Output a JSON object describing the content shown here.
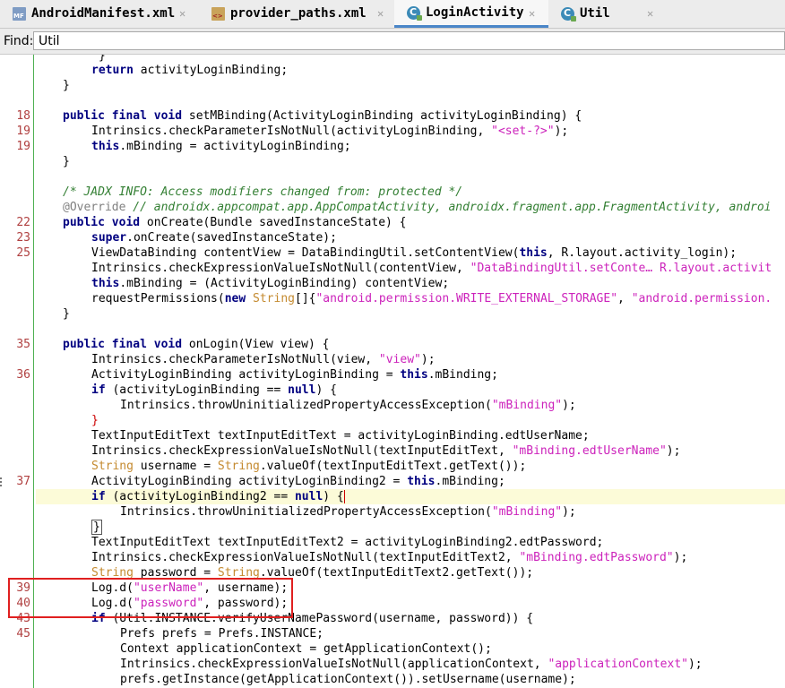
{
  "tabs": [
    {
      "label": "AndroidManifest.xml",
      "icon": "manifest-file-icon",
      "active": false
    },
    {
      "label": "provider_paths.xml",
      "icon": "xml-file-icon",
      "active": false
    },
    {
      "label": "LoginActivity",
      "icon": "java-class-icon",
      "active": true
    },
    {
      "label": "Util",
      "icon": "java-class-icon",
      "active": false
    }
  ],
  "close_glyph": "✕",
  "find": {
    "label": "Find:",
    "value": "Util"
  },
  "code": {
    "l0": {
      "num": "",
      "a": "}"
    },
    "l1": {
      "num": "",
      "kw1": "return",
      "a": " activityLoginBinding;"
    },
    "l2": {
      "num": "",
      "a": "}"
    },
    "l4": {
      "num": "18",
      "kw1": "public final void",
      "a": " setMBinding(ActivityLoginBinding activityLoginBinding) {"
    },
    "l5": {
      "num": "19",
      "a": "Intrinsics.checkParameterIsNotNull(activityLoginBinding, ",
      "s1": "\"<set-?>\"",
      "b": ");"
    },
    "l6": {
      "num": "19",
      "kw1": "this",
      "a": ".mBinding = activityLoginBinding;"
    },
    "l7": {
      "num": "",
      "a": "}"
    },
    "l9": {
      "num": "",
      "c": "/* JADX INFO: Access modifiers changed from: protected */"
    },
    "l10": {
      "num": "",
      "ann": "@Override",
      "c": " // androidx.appcompat.app.AppCompatActivity, androidx.fragment.app.FragmentActivity, androi"
    },
    "l11": {
      "num": "22",
      "kw1": "public void",
      "a": " onCreate(Bundle savedInstanceState) {"
    },
    "l12": {
      "num": "23",
      "kw1": "super",
      "a": ".onCreate(savedInstanceState);"
    },
    "l13": {
      "num": "25",
      "a": "ViewDataBinding contentView = DataBindingUtil.setContentView(",
      "kw2": "this",
      "b": ", R.layout.activity_login);"
    },
    "l14": {
      "num": "",
      "a": "Intrinsics.checkExpressionValueIsNotNull(contentView, ",
      "s1": "\"DataBindingUtil.setConte… R.layout.activit"
    },
    "l15": {
      "num": "",
      "kw1": "this",
      "a": ".mBinding = (ActivityLoginBinding) contentView;"
    },
    "l16": {
      "num": "",
      "a": "requestPermissions(",
      "kw2": "new",
      "t": " String",
      "b": "[]{",
      "s1": "\"android.permission.WRITE_EXTERNAL_STORAGE\"",
      "c2": ", ",
      "s2": "\"android.permission."
    },
    "l17": {
      "num": "",
      "a": "}"
    },
    "l19": {
      "num": "35",
      "kw1": "public final void",
      "a": " onLogin(View view) {"
    },
    "l20": {
      "num": "",
      "a": "Intrinsics.checkParameterIsNotNull(view, ",
      "s1": "\"view\"",
      "b": ");"
    },
    "l21": {
      "num": "36",
      "a": "ActivityLoginBinding activityLoginBinding = ",
      "kw2": "this",
      "b": ".mBinding;"
    },
    "l22": {
      "num": "",
      "kw1": "if",
      "a": " (activityLoginBinding == ",
      "kw2": "null",
      "b": ") {"
    },
    "l23": {
      "num": "",
      "a": "Intrinsics.throwUninitializedPropertyAccessException(",
      "s1": "\"mBinding\"",
      "b": ");"
    },
    "l24": {
      "num": "",
      "a": "}"
    },
    "l25": {
      "num": "",
      "a": "TextInputEditText textInputEditText = activityLoginBinding.edtUserName;"
    },
    "l26": {
      "num": "",
      "a": "Intrinsics.checkExpressionValueIsNotNull(textInputEditText, ",
      "s1": "\"mBinding.edtUserName\"",
      "b": ");"
    },
    "l27": {
      "num": "",
      "t": "String",
      "a": " username = ",
      "t2": "String",
      "b": ".valueOf(textInputEditText.getText());"
    },
    "l28": {
      "num": "37",
      "a": "ActivityLoginBinding activityLoginBinding2 = ",
      "kw2": "this",
      "b": ".mBinding;"
    },
    "l29": {
      "num": "",
      "kw1": "if",
      "a": " (activityLoginBinding2 == ",
      "kw2": "null",
      "b": ") {"
    },
    "l30": {
      "num": "",
      "a": "Intrinsics.throwUninitializedPropertyAccessException(",
      "s1": "\"mBinding\"",
      "b": ");"
    },
    "l31": {
      "num": "",
      "a": "}"
    },
    "l32": {
      "num": "",
      "a": "TextInputEditText textInputEditText2 = activityLoginBinding2.edtPassword;"
    },
    "l33": {
      "num": "",
      "a": "Intrinsics.checkExpressionValueIsNotNull(textInputEditText2, ",
      "s1": "\"mBinding.edtPassword\"",
      "b": ");"
    },
    "l34": {
      "num": "",
      "t": "String",
      "a": " password = ",
      "t2": "String",
      "b": ".valueOf(textInputEditText2.getText());"
    },
    "l35": {
      "num": "39",
      "a": "Log.d(",
      "s1": "\"userName\"",
      "b": ", username);"
    },
    "l36": {
      "num": "40",
      "a": "Log.d(",
      "s1": "\"password\"",
      "b": ", password);"
    },
    "l37": {
      "num": "43",
      "kw1": "if",
      "a": " (Util.INSTANCE.verifyUserNamePassword(username, password)) {"
    },
    "l38": {
      "num": "45",
      "a": "Prefs prefs = Prefs.INSTANCE;"
    },
    "l39": {
      "num": "",
      "a": "Context applicationContext = getApplicationContext();"
    },
    "l40": {
      "num": "",
      "a": "Intrinsics.checkExpressionValueIsNotNull(applicationContext, ",
      "s1": "\"applicationContext\"",
      "b": ");"
    },
    "l41": {
      "num": "",
      "a": "prefs.getInstance(getApplicationContext()).setUsername(username);"
    }
  }
}
